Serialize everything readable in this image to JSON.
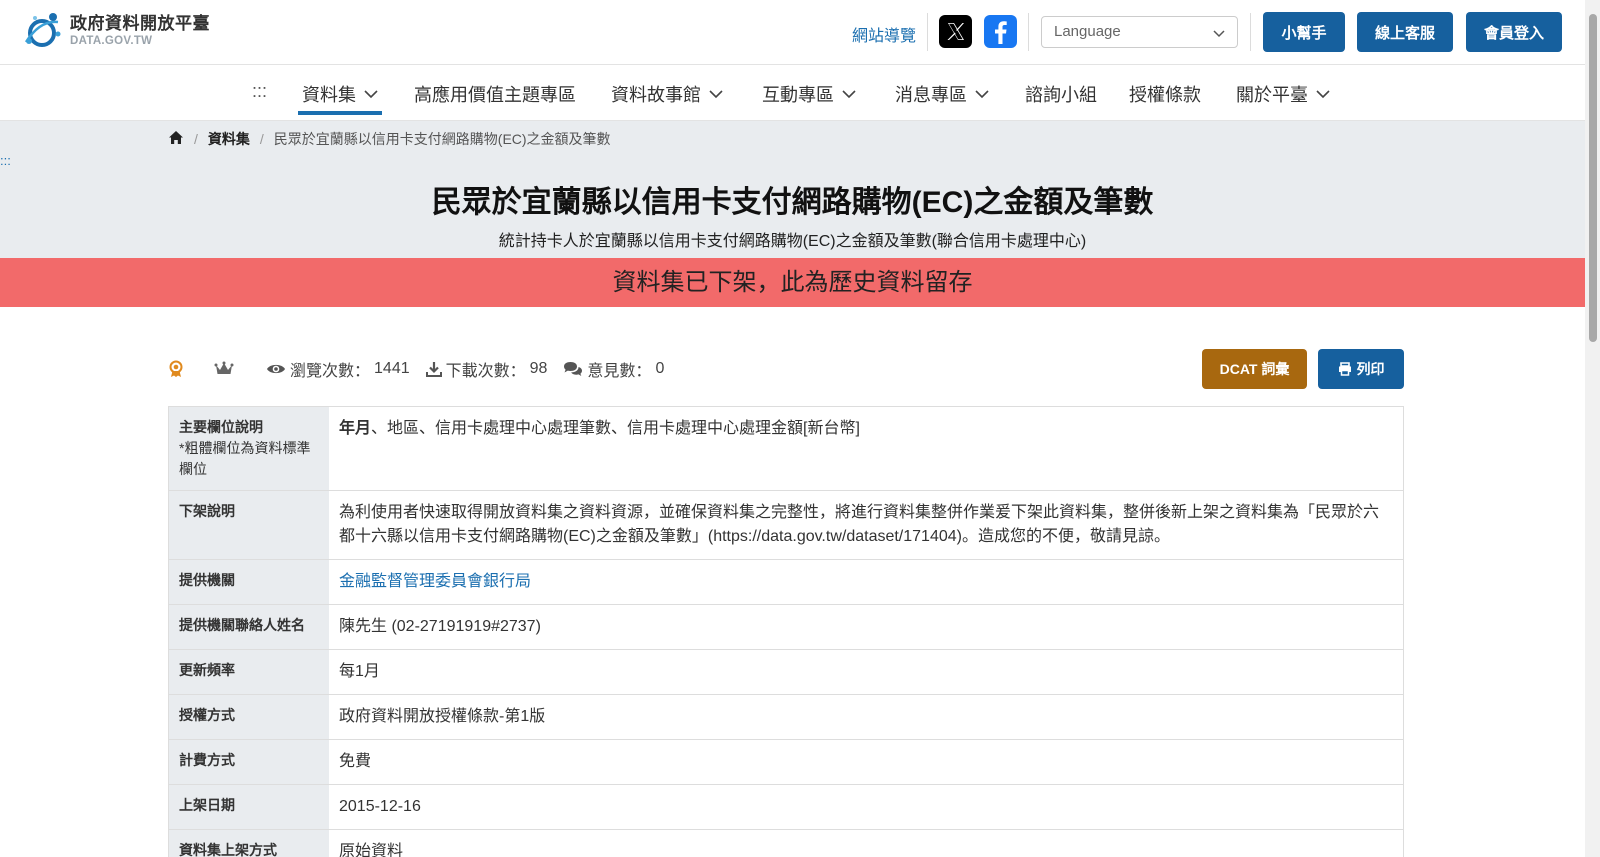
{
  "header": {
    "logo_title": "政府資料開放平臺",
    "logo_sub": "DATA.GOV.TW",
    "sitemap_label": "網站導覽",
    "language_placeholder": "Language",
    "helper_button": "小幫手",
    "support_button": "線上客服",
    "login_button": "會員登入"
  },
  "nav": {
    "anchor": ":::",
    "items": [
      "資料集",
      "高應用價值主題專區",
      "資料故事館",
      "互動專區",
      "消息專區",
      "諮詢小組",
      "授權條款",
      "關於平臺"
    ]
  },
  "breadcrumb": {
    "level1": "資料集",
    "current": "民眾於宜蘭縣以信用卡支付網路購物(EC)之金額及筆數"
  },
  "hero": {
    "anchor": ":::",
    "title": "民眾於宜蘭縣以信用卡支付網路購物(EC)之金額及筆數",
    "subtitle": "統計持卡人於宜蘭縣以信用卡支付網路購物(EC)之金額及筆數(聯合信用卡處理中心)",
    "alert": "資料集已下架，此為歷史資料留存"
  },
  "stats": {
    "views_label": "瀏覽次數：",
    "views": "1441",
    "downloads_label": "下載次數：",
    "downloads": "98",
    "comments_label": "意見數：",
    "comments": "0",
    "dcat_button": "DCAT 詞彙",
    "print_button": "列印"
  },
  "table": {
    "rows": [
      {
        "key": "主要欄位說明",
        "note": "*粗體欄位為資料標準欄位",
        "val_bold": "年月",
        "val": "、地區、信用卡處理中心處理筆數、信用卡處理中心處理金額[新台幣]"
      },
      {
        "key": "下架說明",
        "val": "為利使用者快速取得開放資料集之資料資源，並確保資料集之完整性，將進行資料集整併作業爰下架此資料集，整併後新上架之資料集為「民眾於六都十六縣以信用卡支付網路購物(EC)之金額及筆數」(https://data.gov.tw/dataset/171404)。造成您的不便，敬請見諒。"
      },
      {
        "key": "提供機關",
        "val": "金融監督管理委員會銀行局"
      },
      {
        "key": "提供機關聯絡人姓名",
        "val": "陳先生 (02-27191919#2737)"
      },
      {
        "key": "更新頻率",
        "val": "每1月"
      },
      {
        "key": "授權方式",
        "val": "政府資料開放授權條款-第1版"
      },
      {
        "key": "計費方式",
        "val": "免費"
      },
      {
        "key": "上架日期",
        "val": "2015-12-16"
      },
      {
        "key": "資料集上架方式",
        "val": "原始資料"
      }
    ]
  },
  "colors": {
    "brand_blue": "#16609e",
    "link_blue": "#1b6fb0",
    "alert_red": "#f26a6a",
    "dcat_gold": "#a8680f"
  }
}
